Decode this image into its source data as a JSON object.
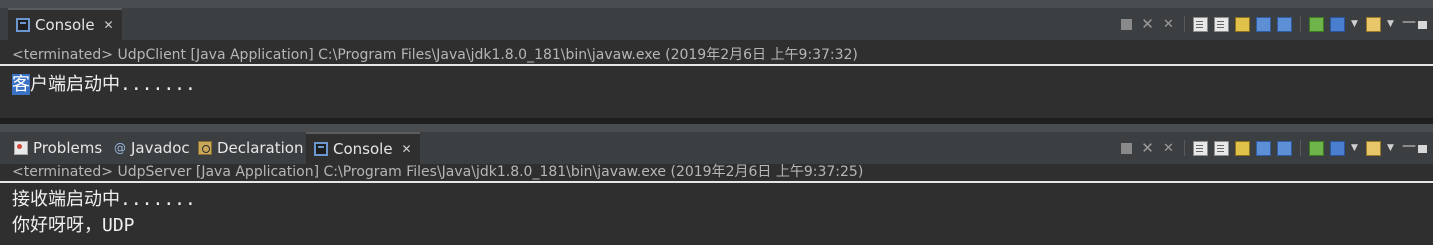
{
  "top_view": {
    "tab_label": "Console",
    "status": "<terminated> UdpClient [Java Application] C:\\Program Files\\Java\\jdk1.8.0_181\\bin\\javaw.exe (2019年2月6日 上午9:37:32)",
    "output": {
      "selected_text": "客",
      "rest_text": "户端启动中......."
    }
  },
  "bottom_view": {
    "tabs": [
      {
        "label": "Problems"
      },
      {
        "label": "Javadoc"
      },
      {
        "label": "Declaration"
      },
      {
        "label": "Console"
      }
    ],
    "status": "<terminated> UdpServer [Java Application] C:\\Program Files\\Java\\jdk1.8.0_181\\bin\\javaw.exe (2019年2月6日 上午9:37:25)",
    "output_lines": [
      "接收端启动中.......",
      "你好呀呀，UDP"
    ]
  },
  "close_glyph": "✕",
  "icons": [
    "console-icon",
    "problems-icon",
    "javadoc-icon",
    "declaration-icon",
    "terminate-icon",
    "remove-launch-icon",
    "remove-all-terminated-icon",
    "clear-console-icon",
    "scroll-lock-icon",
    "word-wrap-icon",
    "show-on-output-icon",
    "show-on-error-icon",
    "pin-console-icon",
    "display-console-icon",
    "new-console-icon",
    "minimize-icon",
    "maximize-icon"
  ]
}
